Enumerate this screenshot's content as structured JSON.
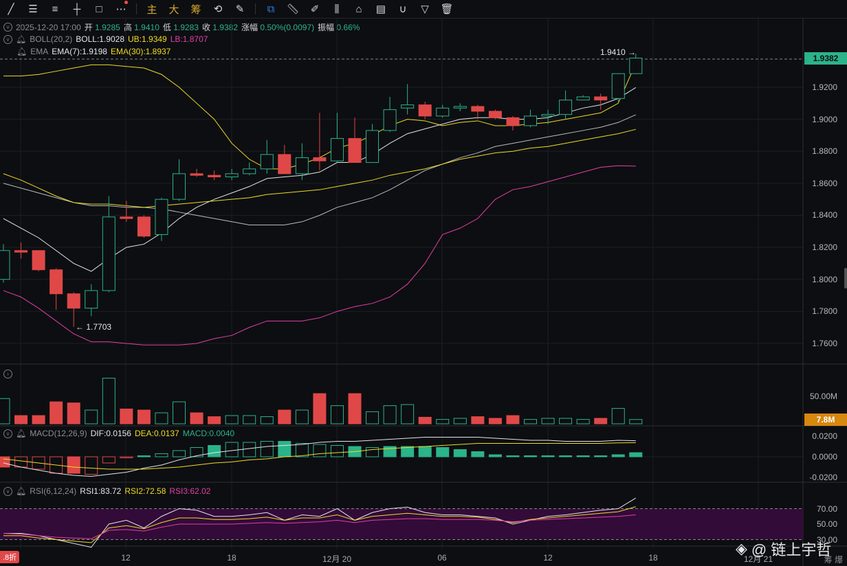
{
  "toolbar": {
    "items": [
      "line-tool",
      "parallel-tool",
      "fib-tool",
      "crosshair-tool",
      "rect-tool",
      "more-tool"
    ],
    "main": "主",
    "big": "大",
    "chips": "筹"
  },
  "ohlc_row": {
    "datetime": "2025-12-20 17:00",
    "open_label": "开",
    "open": "1.9285",
    "high_label": "高",
    "high": "1.9410",
    "low_label": "低",
    "low": "1.9283",
    "close_label": "收",
    "close": "1.9382",
    "change_label": "涨幅",
    "change": "0.50%(0.0097)",
    "amp_label": "振幅",
    "amp": "0.66%"
  },
  "boll": {
    "name": "BOLL(20,2)",
    "mid": "BOLL:1.9028",
    "ub": "UB:1.9349",
    "lb": "LB:1.8707"
  },
  "ema": {
    "name": "EMA",
    "ema7": "EMA(7):1.9198",
    "ema30": "EMA(30):1.8937"
  },
  "macd": {
    "name": "MACD(12,26,9)",
    "dif": "DIF:0.0156",
    "dea": "DEA:0.0137",
    "macd": "MACD:0.0040"
  },
  "rsi": {
    "name": "RSI(6,12,24)",
    "rsi1": "RSI1:83.72",
    "rsi2": "RSI2:72.58",
    "rsi3": "RSI3:62.02"
  },
  "price_axis": [
    "1.9200",
    "1.9000",
    "1.8800",
    "1.8600",
    "1.8400",
    "1.8200",
    "1.8000",
    "1.7800",
    "1.7600"
  ],
  "current_price": "1.9382",
  "high_marker": "1.9410 →",
  "low_marker": "← 1.7703",
  "volume_axis": "50.00M",
  "volume_tag": "7.8M",
  "macd_axis": [
    "0.0200",
    "0.0000",
    "-0.0200"
  ],
  "rsi_axis": [
    "70.00",
    "50.00",
    "30.00"
  ],
  "x_axis": [
    "12",
    "18",
    "12月 20",
    "06",
    "12",
    "18",
    "12月 21"
  ],
  "discount_badge": ".8折",
  "bottom_right": "筹  爆",
  "watermark": "@ 链上宇哲",
  "colors": {
    "up": "#2bb38a",
    "down": "#e04848",
    "ema30": "#f0dc26",
    "lb": "#e040a8"
  },
  "chart_data": {
    "type": "candlestick",
    "candles": [
      [
        1.8,
        1.822,
        1.798,
        1.818
      ],
      [
        1.818,
        1.823,
        1.813,
        1.817
      ],
      [
        1.818,
        1.818,
        1.805,
        1.806
      ],
      [
        1.806,
        1.807,
        1.781,
        1.791
      ],
      [
        1.791,
        1.792,
        1.7703,
        1.782
      ],
      [
        1.782,
        1.797,
        1.777,
        1.793
      ],
      [
        1.793,
        1.852,
        1.792,
        1.839
      ],
      [
        1.839,
        1.849,
        1.836,
        1.838
      ],
      [
        1.839,
        1.84,
        1.826,
        1.827
      ],
      [
        1.828,
        1.851,
        1.824,
        1.85
      ],
      [
        1.85,
        1.875,
        1.849,
        1.866
      ],
      [
        1.866,
        1.869,
        1.864,
        1.865
      ],
      [
        1.865,
        1.868,
        1.862,
        1.864
      ],
      [
        1.864,
        1.869,
        1.862,
        1.866
      ],
      [
        1.866,
        1.873,
        1.865,
        1.869
      ],
      [
        1.869,
        1.887,
        1.866,
        1.878
      ],
      [
        1.878,
        1.884,
        1.866,
        1.866
      ],
      [
        1.866,
        1.885,
        1.862,
        1.876
      ],
      [
        1.876,
        1.904,
        1.868,
        1.874
      ],
      [
        1.874,
        1.904,
        1.873,
        1.888
      ],
      [
        1.888,
        1.901,
        1.873,
        1.873
      ],
      [
        1.873,
        1.897,
        1.873,
        1.893
      ],
      [
        1.893,
        1.914,
        1.892,
        1.906
      ],
      [
        1.907,
        1.922,
        1.903,
        1.909
      ],
      [
        1.909,
        1.911,
        1.9,
        1.902
      ],
      [
        1.902,
        1.909,
        1.901,
        1.907
      ],
      [
        1.907,
        1.91,
        1.905,
        1.908
      ],
      [
        1.908,
        1.909,
        1.9,
        1.905
      ],
      [
        1.905,
        1.906,
        1.9,
        1.901
      ],
      [
        1.901,
        1.902,
        1.893,
        1.896
      ],
      [
        1.896,
        1.906,
        1.895,
        1.902
      ],
      [
        1.902,
        1.906,
        1.897,
        1.903
      ],
      [
        1.903,
        1.918,
        1.9,
        1.912
      ],
      [
        1.912,
        1.915,
        1.912,
        1.914
      ],
      [
        1.914,
        1.916,
        1.906,
        1.912
      ],
      [
        1.913,
        1.928,
        1.911,
        1.9285
      ],
      [
        1.9285,
        1.941,
        1.9283,
        1.9382
      ]
    ],
    "ub": [
      1.927,
      1.927,
      1.928,
      1.93,
      1.932,
      1.934,
      1.934,
      1.933,
      1.932,
      1.928,
      1.92,
      1.91,
      1.9,
      1.885,
      1.875,
      1.869,
      1.869,
      1.872,
      1.876,
      1.882,
      1.885,
      1.89,
      1.896,
      1.9,
      1.899,
      1.896,
      1.898,
      1.899,
      1.896,
      1.896,
      1.897,
      1.898,
      1.9,
      1.902,
      1.904,
      1.91,
      1.935
    ],
    "lb": [
      1.793,
      1.789,
      1.782,
      1.774,
      1.766,
      1.761,
      1.761,
      1.76,
      1.759,
      1.759,
      1.759,
      1.76,
      1.763,
      1.765,
      1.77,
      1.774,
      1.774,
      1.774,
      1.776,
      1.78,
      1.783,
      1.785,
      1.789,
      1.797,
      1.81,
      1.828,
      1.832,
      1.838,
      1.85,
      1.856,
      1.858,
      1.861,
      1.864,
      1.867,
      1.87,
      1.871,
      1.8707
    ],
    "mid": [
      1.86,
      1.857,
      1.854,
      1.851,
      1.848,
      1.846,
      1.846,
      1.845,
      1.845,
      1.844,
      1.842,
      1.84,
      1.838,
      1.836,
      1.834,
      1.834,
      1.834,
      1.836,
      1.84,
      1.845,
      1.848,
      1.851,
      1.856,
      1.862,
      1.868,
      1.872,
      1.876,
      1.879,
      1.883,
      1.885,
      1.887,
      1.889,
      1.891,
      1.893,
      1.895,
      1.898,
      1.9028
    ],
    "ema7": [
      1.838,
      1.832,
      1.826,
      1.818,
      1.81,
      1.805,
      1.813,
      1.82,
      1.822,
      1.829,
      1.838,
      1.845,
      1.85,
      1.854,
      1.858,
      1.863,
      1.864,
      1.865,
      1.867,
      1.873,
      1.873,
      1.878,
      1.885,
      1.891,
      1.894,
      1.897,
      1.9,
      1.901,
      1.901,
      1.9,
      1.9,
      1.901,
      1.904,
      1.907,
      1.909,
      1.913,
      1.9198
    ],
    "ema30": [
      1.866,
      1.862,
      1.857,
      1.852,
      1.848,
      1.847,
      1.847,
      1.846,
      1.845,
      1.846,
      1.847,
      1.848,
      1.849,
      1.85,
      1.851,
      1.853,
      1.854,
      1.855,
      1.856,
      1.858,
      1.86,
      1.862,
      1.865,
      1.867,
      1.869,
      1.872,
      1.875,
      1.877,
      1.879,
      1.88,
      1.882,
      1.883,
      1.885,
      1.887,
      1.889,
      1.891,
      1.8937
    ],
    "volume_m": [
      46,
      15,
      15,
      40,
      38,
      25,
      83,
      27,
      25,
      20,
      40,
      20,
      13,
      15,
      15,
      13,
      25,
      25,
      55,
      33,
      55,
      22,
      33,
      35,
      12,
      8,
      10,
      13,
      10,
      15,
      8,
      10,
      10,
      8,
      10,
      28,
      7.8
    ],
    "macd_hist": [
      -0.01,
      -0.01,
      -0.012,
      -0.016,
      -0.016,
      -0.017,
      -0.006,
      -0.001,
      0.001,
      0.003,
      0.006,
      0.009,
      0.011,
      0.014,
      0.014,
      0.015,
      0.015,
      0.013,
      0.012,
      0.011,
      0.01,
      0.009,
      0.01,
      0.01,
      0.01,
      0.009,
      0.007,
      0.005,
      0.002,
      0.001,
      0.001,
      0.001,
      0.001,
      0.001,
      0.001,
      0.002,
      0.004
    ],
    "dif": [
      -0.006,
      -0.01,
      -0.013,
      -0.016,
      -0.018,
      -0.019,
      -0.017,
      -0.015,
      -0.011,
      -0.008,
      -0.003,
      0.001,
      0.004,
      0.006,
      0.008,
      0.01,
      0.011,
      0.012,
      0.014,
      0.015,
      0.015,
      0.016,
      0.017,
      0.018,
      0.019,
      0.019,
      0.019,
      0.019,
      0.018,
      0.017,
      0.016,
      0.016,
      0.015,
      0.015,
      0.015,
      0.016,
      0.0156
    ],
    "dea": [
      -0.002,
      -0.004,
      -0.006,
      -0.008,
      -0.01,
      -0.011,
      -0.012,
      -0.012,
      -0.012,
      -0.011,
      -0.01,
      -0.008,
      -0.006,
      -0.005,
      -0.003,
      -0.002,
      0.0,
      0.001,
      0.003,
      0.004,
      0.005,
      0.007,
      0.008,
      0.009,
      0.01,
      0.011,
      0.012,
      0.013,
      0.013,
      0.013,
      0.013,
      0.013,
      0.013,
      0.013,
      0.013,
      0.0135,
      0.0137
    ],
    "rsi1": [
      38,
      38,
      35,
      30,
      25,
      20,
      50,
      55,
      45,
      60,
      70,
      68,
      60,
      60,
      62,
      65,
      55,
      62,
      60,
      70,
      55,
      65,
      70,
      72,
      65,
      62,
      62,
      60,
      58,
      50,
      55,
      60,
      62,
      65,
      68,
      70,
      83.72
    ],
    "rsi2": [
      35,
      35,
      32,
      30,
      28,
      26,
      45,
      48,
      44,
      52,
      58,
      58,
      56,
      56,
      57,
      59,
      55,
      58,
      58,
      62,
      55,
      60,
      62,
      64,
      62,
      60,
      60,
      59,
      56,
      52,
      56,
      58,
      60,
      62,
      64,
      66,
      72.58
    ],
    "rsi3": [
      38,
      37,
      35,
      33,
      32,
      31,
      42,
      43,
      41,
      46,
      50,
      50,
      50,
      50,
      51,
      52,
      51,
      52,
      53,
      55,
      52,
      55,
      56,
      57,
      57,
      56,
      56,
      56,
      55,
      53,
      55,
      56,
      57,
      58,
      59,
      60,
      62.02
    ]
  }
}
